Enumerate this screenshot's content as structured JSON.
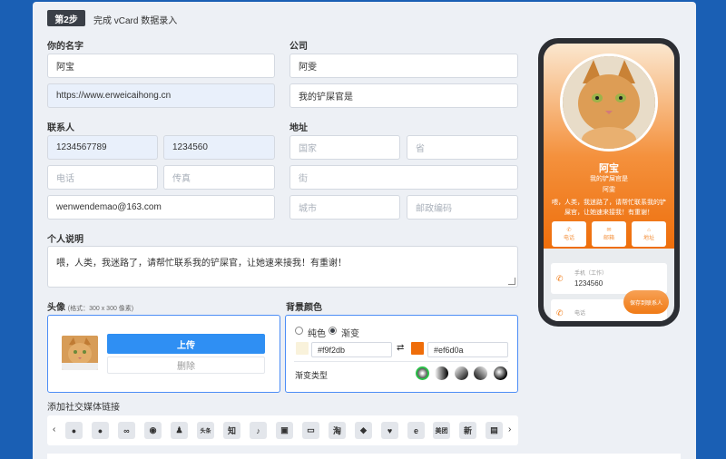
{
  "step": {
    "badge": "第2步",
    "title": "完成 vCard 数据录入"
  },
  "labels": {
    "name": "你的名字",
    "company": "公司",
    "contact": "联系人",
    "address": "地址",
    "bio": "个人说明",
    "avatar": "头像",
    "avatar_hint": "(格式：300 x 300 像素)",
    "bgcolor": "背景颜色",
    "social": "添加社交媒体链接"
  },
  "fields": {
    "name": "阿宝",
    "company": "阿雯",
    "website": "https://www.erweicaihong.cn",
    "title": "我的铲屎官是",
    "mobile": "1234567789",
    "work_phone": "1234560",
    "phone_ph": "电话",
    "fax_ph": "传真",
    "email": "wenwendemao@163.com",
    "country_ph": "国家",
    "province_ph": "省",
    "street_ph": "街",
    "city_ph": "城市",
    "zip_ph": "邮政编码",
    "bio": "喂，人类，我迷路了，请帮忙联系我的铲屎官，让她速来接我！有重谢！"
  },
  "avatar": {
    "upload": "上传",
    "delete": "删除"
  },
  "bg": {
    "solid": "纯色",
    "gradient": "渐变",
    "color1": "#f9f2db",
    "color2": "#ef6d0a",
    "gradient_type": "渐变类型"
  },
  "social_icons": [
    "wechat-icon",
    "wechat-moments-icon",
    "link-icon",
    "weibo-icon",
    "qq-icon",
    "toutiao-icon",
    "zhihu-icon",
    "douyin-icon",
    "kuaishou-icon",
    "bilibili-icon",
    "taobao-icon",
    "xianyu-icon",
    "gift-icon",
    "edge-icon",
    "meituan-icon",
    "news-icon",
    "more-icon"
  ],
  "social_text": {
    "toutiao": "头条",
    "zhihu": "知",
    "meituan": "美团",
    "news": "新"
  },
  "phone": {
    "name": "阿宝",
    "title": "我的铲屎官是",
    "company": "阿雯",
    "note": "喂，人类，我迷路了，请帮忙联系我的铲屎官，让她速来接我！有重谢！",
    "actions": [
      "电话",
      "邮箱",
      "地址"
    ],
    "card_label": "手机（工作）",
    "card_value": "1234560",
    "card2_label": "电话",
    "save": "保存到联系人"
  },
  "colors": {
    "accent": "#2f8ff3",
    "orange": "#ef6d0a",
    "bg": "#1a5fb4"
  }
}
